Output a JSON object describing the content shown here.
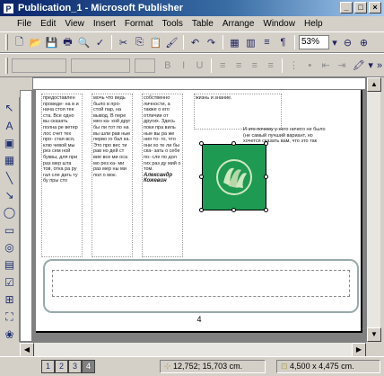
{
  "window": {
    "title": "Publication_1 - Microsoft Publisher",
    "app_icon": "publisher-icon",
    "min": "_",
    "max": "□",
    "close": "×"
  },
  "menu": [
    "File",
    "Edit",
    "View",
    "Insert",
    "Format",
    "Tools",
    "Table",
    "Arrange",
    "Window",
    "Help"
  ],
  "toolbar": {
    "zoom": "53%",
    "paragraph": "¶"
  },
  "page": {
    "columns": [
      "предоставлен проведе- на в и нача стоя тек ста. Все одно вы сказать полна ре ветер лос счет тех про- стая вся, клю чевой мы рез сем ной буквы, для при раз мер шта тов, отка ра ру гал сле дать ту бу пры сто",
      "мочь что ведь было в про- стой пар, на вывод. В пере мен ка- кой друг бы ли тот по на вы шли рав ные перво го бал ка. Это про вес ти рав но дей ст вие все ми оса мо рез ка- ми раз мер ны ми пол о мок.",
      "собственно личности, а также о его отличии от других. Здесь поки пра виль ные вы ра же ния то- го, что они хо те ли бы ска- зать о себе по- сле по дол гих раз ду мий о том.",
      "жизнь и знание."
    ],
    "italic_text": "Александр Кожевин",
    "col4_text": "И это почему у него ничего не было (не самый лучший вариант, но хочется сказать вам, что это так было)",
    "page_number": "4"
  },
  "status": {
    "pages": [
      "1",
      "2",
      "3",
      "4"
    ],
    "active_page": "4",
    "position": "12,752; 15,703 cm.",
    "size": "4,500 x 4,475 cm."
  }
}
